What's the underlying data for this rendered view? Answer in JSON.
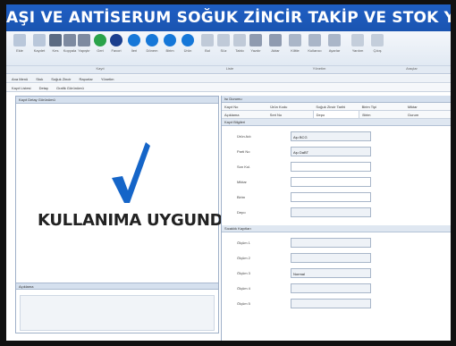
{
  "window": {
    "title": "AŞI VE ANTİSERUM SOĞUK ZİNCİR TAKİP VE STOK YÖNETİM SİSTEMİ"
  },
  "ribbon": {
    "buttons": [
      {
        "icon": "new-doc-icon",
        "color": "#b9c7da",
        "label": "Ekle"
      },
      {
        "icon": "save-icon",
        "color": "#b9c7da",
        "label": "Kaydet"
      },
      {
        "icon": "cut-icon",
        "color": "#5b6b82",
        "label": "Kes"
      },
      {
        "icon": "copy-icon",
        "color": "#7d8aa0",
        "label": "Kopyala"
      },
      {
        "icon": "paste-icon",
        "color": "#7d8aa0",
        "label": "Yapıştır"
      },
      {
        "icon": "undo-icon",
        "color": "#2aa34a",
        "label": "Geri"
      },
      {
        "icon": "star-icon",
        "color": "#1b3f8e",
        "label": "Favori"
      },
      {
        "icon": "circle-icon",
        "color": "#1577d8",
        "label": "İleri"
      },
      {
        "icon": "circle-icon",
        "color": "#1577d8",
        "label": "Dönem"
      },
      {
        "icon": "circle-icon",
        "color": "#1577d8",
        "label": "Birim"
      },
      {
        "icon": "circle-icon",
        "color": "#1577d8",
        "label": "Ürün"
      },
      {
        "icon": "search-icon",
        "color": "#c0cad8",
        "label": "Bul"
      },
      {
        "icon": "filter-icon",
        "color": "#c0cad8",
        "label": "Süz"
      },
      {
        "icon": "grid-icon",
        "color": "#c0cad8",
        "label": "Tablo"
      },
      {
        "icon": "print-icon",
        "color": "#8f9bb0",
        "label": "Yazdır"
      },
      {
        "icon": "export-icon",
        "color": "#8f9bb0",
        "label": "Aktar"
      },
      {
        "icon": "lock-icon",
        "color": "#aab6c8",
        "label": "Kilitle"
      },
      {
        "icon": "users-icon",
        "color": "#aab6c8",
        "label": "Kullanıcı"
      },
      {
        "icon": "settings-icon",
        "color": "#aab6c8",
        "label": "Ayarlar"
      },
      {
        "icon": "help-icon",
        "color": "#c4cedb",
        "label": "Yardım"
      },
      {
        "icon": "exit-icon",
        "color": "#c4cedb",
        "label": "Çıkış"
      }
    ],
    "groups": [
      "Kayıt",
      "Liste",
      "Yönetim",
      "Araçlar"
    ]
  },
  "menubar": {
    "items": [
      "Ana Menü",
      "Stok",
      "Soğuk Zincir",
      "Raporlar",
      "Yönetim"
    ]
  },
  "subtabs": {
    "items": [
      "Kayıt Listesi",
      "Detay",
      "Grafik Görünümü"
    ]
  },
  "left_panel": {
    "header": "Kayıt Detay Görünümü",
    "status_text": "KULLANIMA UYGUNDUR",
    "check_color": "#1565c8",
    "lower_header": "Açıklama"
  },
  "right_panel": {
    "header": "Isı Durumu",
    "columns": [
      "Kayıt No",
      "Ürün Kodu",
      "Soğuk Zincir Tarihi",
      "Birim Tipi",
      "Miktar",
      "Açıklama",
      "Seri No",
      "Depo",
      "Birim",
      "Durum"
    ],
    "active_column_index": 7,
    "section1_header": "Kayıt Bilgileri",
    "section1_rows": [
      {
        "label": "Ürün Adı",
        "value": "Aşı BCG",
        "white": false
      },
      {
        "label": "Parti No",
        "value": "Aşı DaBT",
        "white": false
      },
      {
        "label": "Son Kul.",
        "value": "",
        "white": true
      },
      {
        "label": "Miktar",
        "value": "",
        "white": true
      },
      {
        "label": "Birim",
        "value": "",
        "white": true
      },
      {
        "label": "Depo",
        "value": "",
        "white": false
      }
    ],
    "section2_header": "Sıcaklık Kayıtları",
    "section2_rows": [
      {
        "label": "Ölçüm 1",
        "value": "",
        "white": false
      },
      {
        "label": "Ölçüm 2",
        "value": "",
        "white": false
      },
      {
        "label": "Ölçüm 3",
        "value": "Normal",
        "white": false
      },
      {
        "label": "Ölçüm 4",
        "value": "",
        "white": false
      },
      {
        "label": "Ölçüm 5",
        "value": "",
        "white": false
      }
    ]
  }
}
